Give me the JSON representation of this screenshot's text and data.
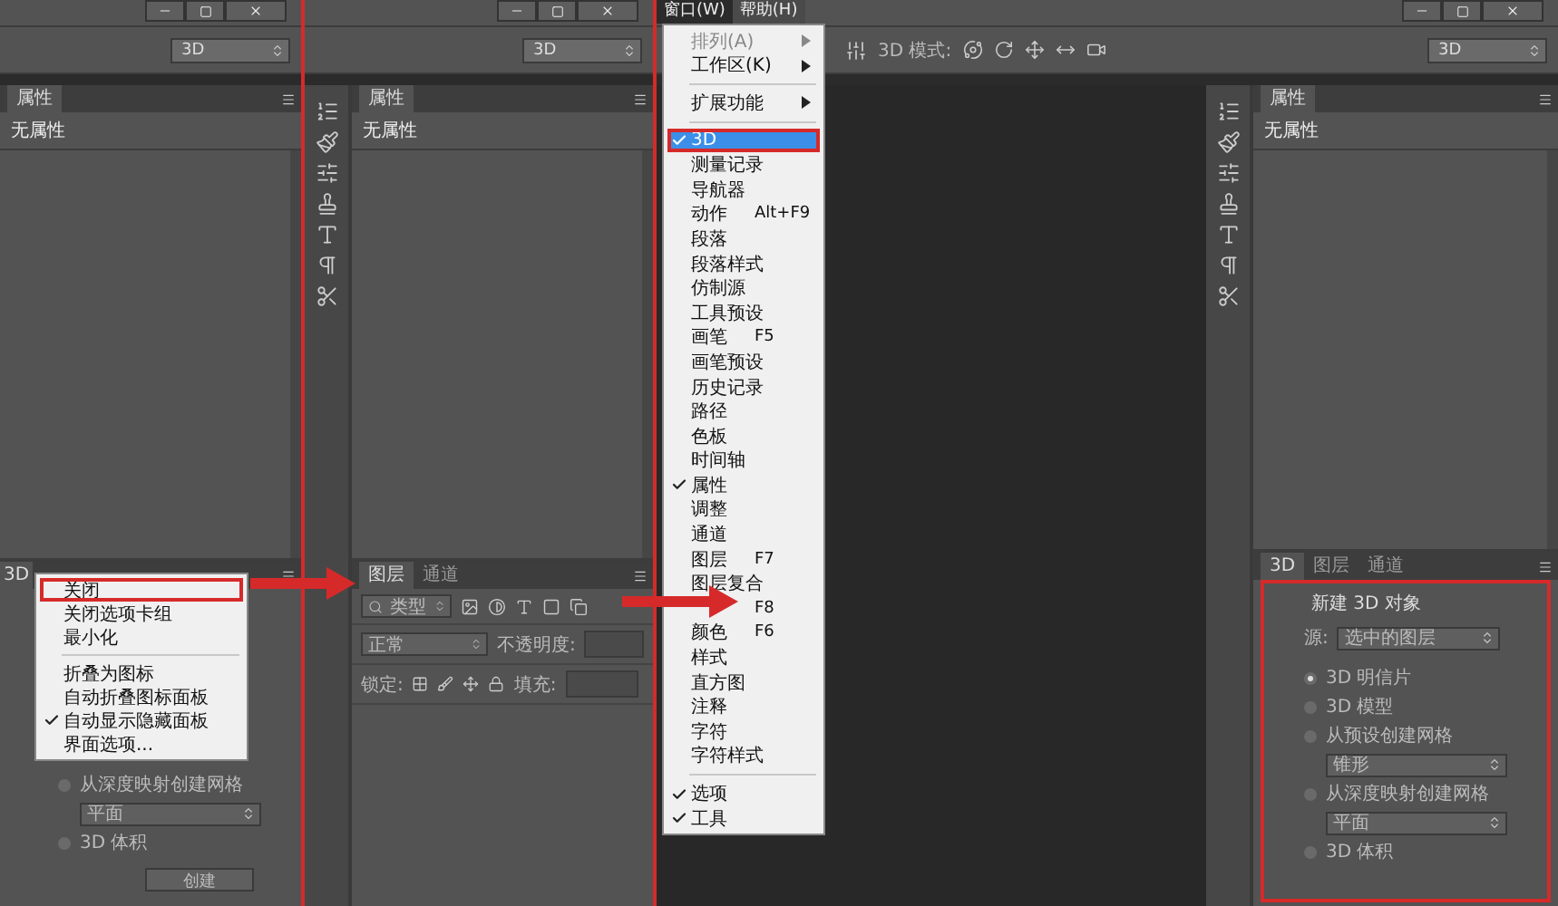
{
  "left_screen": {
    "workspace": "3D",
    "properties_tab": "属性",
    "properties_text": "无属性",
    "bottom_tabs": [
      {
        "label": "3D",
        "selected": true
      }
    ],
    "options": [
      {
        "kind": "radio",
        "label": "从深度映射创建网格",
        "selected": false
      },
      {
        "kind": "select",
        "value": "平面"
      },
      {
        "kind": "radio",
        "label": "3D 体积",
        "selected": false
      }
    ],
    "create_button": "创建",
    "context_menu": [
      {
        "kind": "item",
        "label": "关闭",
        "checked": false,
        "highlighted": true
      },
      {
        "kind": "item",
        "label": "关闭选项卡组",
        "checked": false,
        "highlighted": false
      },
      {
        "kind": "item",
        "label": "最小化",
        "checked": false,
        "highlighted": false
      },
      {
        "kind": "separator"
      },
      {
        "kind": "item",
        "label": "折叠为图标",
        "checked": false,
        "highlighted": false
      },
      {
        "kind": "item",
        "label": "自动折叠图标面板",
        "checked": false,
        "highlighted": false
      },
      {
        "kind": "item",
        "label": "自动显示隐藏面板",
        "checked": true,
        "highlighted": false
      },
      {
        "kind": "item",
        "label": "界面选项...",
        "checked": false,
        "highlighted": false
      }
    ]
  },
  "middle_screen": {
    "workspace": "3D",
    "properties_tab": "属性",
    "properties_text": "无属性",
    "layer_tabs": [
      {
        "label": "图层",
        "selected": true
      },
      {
        "label": "通道",
        "selected": false
      }
    ],
    "filter": "类型",
    "blend_mode": "正常",
    "opacity_label": "不透明度:",
    "lock_label": "锁定:",
    "fill_label": "填充:"
  },
  "right_screen": {
    "menubar": [
      {
        "label": "窗口(W)",
        "selected": true
      },
      {
        "label": "帮助(H)",
        "selected": false
      }
    ],
    "window_menu": [
      {
        "kind": "item",
        "label": "排列(A)",
        "submenu": true,
        "disabled": true,
        "checked": false,
        "highlighted": false
      },
      {
        "kind": "item",
        "label": "工作区(K)",
        "submenu": true,
        "disabled": false,
        "checked": false,
        "highlighted": false
      },
      {
        "kind": "separator"
      },
      {
        "kind": "item",
        "label": "扩展功能",
        "submenu": true,
        "disabled": false,
        "checked": false,
        "highlighted": false
      },
      {
        "kind": "separator"
      },
      {
        "kind": "item",
        "label": "3D",
        "submenu": false,
        "disabled": false,
        "checked": true,
        "highlighted": true
      },
      {
        "kind": "item",
        "label": "测量记录",
        "submenu": false,
        "disabled": false,
        "checked": false,
        "highlighted": false
      },
      {
        "kind": "item",
        "label": "导航器",
        "submenu": false,
        "disabled": false,
        "checked": false,
        "highlighted": false
      },
      {
        "kind": "item",
        "label": "动作",
        "shortcut": "Alt+F9",
        "submenu": false,
        "disabled": false,
        "checked": false,
        "highlighted": false
      },
      {
        "kind": "item",
        "label": "段落",
        "submenu": false,
        "disabled": false,
        "checked": false,
        "highlighted": false
      },
      {
        "kind": "item",
        "label": "段落样式",
        "submenu": false,
        "disabled": false,
        "checked": false,
        "highlighted": false
      },
      {
        "kind": "item",
        "label": "仿制源",
        "submenu": false,
        "disabled": false,
        "checked": false,
        "highlighted": false
      },
      {
        "kind": "item",
        "label": "工具预设",
        "submenu": false,
        "disabled": false,
        "checked": false,
        "highlighted": false
      },
      {
        "kind": "item",
        "label": "画笔",
        "shortcut": "F5",
        "submenu": false,
        "disabled": false,
        "checked": false,
        "highlighted": false
      },
      {
        "kind": "item",
        "label": "画笔预设",
        "submenu": false,
        "disabled": false,
        "checked": false,
        "highlighted": false
      },
      {
        "kind": "item",
        "label": "历史记录",
        "submenu": false,
        "disabled": false,
        "checked": false,
        "highlighted": false
      },
      {
        "kind": "item",
        "label": "路径",
        "submenu": false,
        "disabled": false,
        "checked": false,
        "highlighted": false
      },
      {
        "kind": "item",
        "label": "色板",
        "submenu": false,
        "disabled": false,
        "checked": false,
        "highlighted": false
      },
      {
        "kind": "item",
        "label": "时间轴",
        "submenu": false,
        "disabled": false,
        "checked": false,
        "highlighted": false
      },
      {
        "kind": "item",
        "label": "属性",
        "submenu": false,
        "disabled": false,
        "checked": true,
        "highlighted": false
      },
      {
        "kind": "item",
        "label": "调整",
        "submenu": false,
        "disabled": false,
        "checked": false,
        "highlighted": false
      },
      {
        "kind": "item",
        "label": "通道",
        "submenu": false,
        "disabled": false,
        "checked": false,
        "highlighted": false
      },
      {
        "kind": "item",
        "label": "图层",
        "shortcut": "F7",
        "submenu": false,
        "disabled": false,
        "checked": false,
        "highlighted": false
      },
      {
        "kind": "item",
        "label": "图层复合",
        "submenu": false,
        "disabled": false,
        "checked": false,
        "highlighted": false
      },
      {
        "kind": "item",
        "shortcut": "F8",
        "submenu": false,
        "disabled": false,
        "checked": false,
        "highlighted": false
      },
      {
        "kind": "item",
        "label": "颜色",
        "shortcut": "F6",
        "submenu": false,
        "disabled": false,
        "checked": false,
        "highlighted": false
      },
      {
        "kind": "item",
        "label": "样式",
        "submenu": false,
        "disabled": false,
        "checked": false,
        "highlighted": false
      },
      {
        "kind": "item",
        "label": "直方图",
        "submenu": false,
        "disabled": false,
        "checked": false,
        "highlighted": false
      },
      {
        "kind": "item",
        "label": "注释",
        "submenu": false,
        "disabled": false,
        "checked": false,
        "highlighted": false
      },
      {
        "kind": "item",
        "label": "字符",
        "submenu": false,
        "disabled": false,
        "checked": false,
        "highlighted": false
      },
      {
        "kind": "item",
        "label": "字符样式",
        "submenu": false,
        "disabled": false,
        "checked": false,
        "highlighted": false
      },
      {
        "kind": "separator"
      },
      {
        "kind": "item",
        "label": "选项",
        "submenu": false,
        "disabled": false,
        "checked": true,
        "highlighted": false
      },
      {
        "kind": "item",
        "label": "工具",
        "submenu": false,
        "disabled": false,
        "checked": true,
        "highlighted": false
      }
    ],
    "mode_label": "3D 模式:",
    "workspace": "3D",
    "properties_tab": "属性",
    "properties_text": "无属性",
    "panel_tabs": [
      {
        "label": "3D",
        "selected": true
      },
      {
        "label": "图层",
        "selected": false
      },
      {
        "label": "通道",
        "selected": false
      }
    ],
    "new_object_title": "新建 3D 对象",
    "source_label": "源:",
    "source_value": "选中的图层",
    "options": [
      {
        "kind": "radio",
        "label": "3D 明信片",
        "selected": true
      },
      {
        "kind": "radio",
        "label": "3D 模型",
        "selected": false
      },
      {
        "kind": "radio",
        "label": "从预设创建网格",
        "selected": false
      },
      {
        "kind": "select",
        "value": "锥形"
      },
      {
        "kind": "radio",
        "label": "从深度映射创建网格",
        "selected": false
      },
      {
        "kind": "select",
        "value": "平面"
      },
      {
        "kind": "radio",
        "label": "3D 体积",
        "selected": false
      }
    ]
  }
}
